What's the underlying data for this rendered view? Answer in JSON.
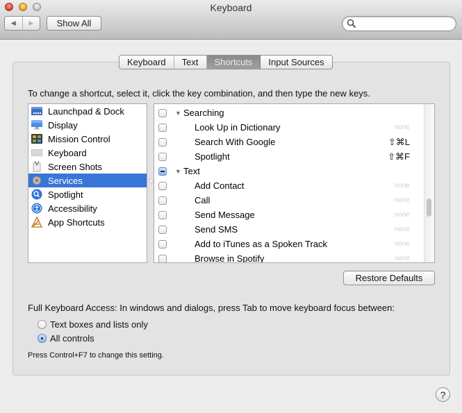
{
  "window": {
    "title": "Keyboard",
    "controls": [
      "close",
      "minimize",
      "zoom"
    ]
  },
  "toolbar": {
    "back_icon": "back-arrow-icon",
    "forward_icon": "forward-arrow-icon",
    "show_all_label": "Show All",
    "search": {
      "value": "",
      "placeholder": "",
      "icon": "magnifier-icon"
    }
  },
  "tabs": [
    {
      "label": "Keyboard",
      "active": false
    },
    {
      "label": "Text",
      "active": false
    },
    {
      "label": "Shortcuts",
      "active": true
    },
    {
      "label": "Input Sources",
      "active": false
    }
  ],
  "instruction": "To change a shortcut, select it, click the key combination, and then type the new keys.",
  "categories": [
    {
      "label": "Launchpad & Dock",
      "icon": "launchpad-dock-icon",
      "selected": false
    },
    {
      "label": "Display",
      "icon": "display-icon",
      "selected": false
    },
    {
      "label": "Mission Control",
      "icon": "mission-control-icon",
      "selected": false
    },
    {
      "label": "Keyboard",
      "icon": "keyboard-icon",
      "selected": false
    },
    {
      "label": "Screen Shots",
      "icon": "screen-shots-icon",
      "selected": false
    },
    {
      "label": "Services",
      "icon": "services-gear-icon",
      "selected": true
    },
    {
      "label": "Spotlight",
      "icon": "spotlight-icon",
      "selected": false
    },
    {
      "label": "Accessibility",
      "icon": "accessibility-icon",
      "selected": false
    },
    {
      "label": "App Shortcuts",
      "icon": "app-shortcuts-icon",
      "selected": false
    }
  ],
  "shortcuts": [
    {
      "type": "group",
      "label": "Searching",
      "checkbox": "unchecked",
      "expanded": true,
      "key": ""
    },
    {
      "type": "item",
      "label": "Look Up in Dictionary",
      "checkbox": "unchecked",
      "key": "none"
    },
    {
      "type": "item",
      "label": "Search With Google",
      "checkbox": "unchecked",
      "key": "⇧⌘L"
    },
    {
      "type": "item",
      "label": "Spotlight",
      "checkbox": "unchecked",
      "key": "⇧⌘F"
    },
    {
      "type": "group",
      "label": "Text",
      "checkbox": "mixed",
      "expanded": true,
      "key": ""
    },
    {
      "type": "item",
      "label": "Add Contact",
      "checkbox": "unchecked",
      "key": "none"
    },
    {
      "type": "item",
      "label": "Call",
      "checkbox": "unchecked",
      "key": "none"
    },
    {
      "type": "item",
      "label": "Send Message",
      "checkbox": "unchecked",
      "key": "none"
    },
    {
      "type": "item",
      "label": "Send SMS",
      "checkbox": "unchecked",
      "key": "none"
    },
    {
      "type": "item",
      "label": "Add to iTunes as a Spoken Track",
      "checkbox": "unchecked",
      "key": "none"
    },
    {
      "type": "item",
      "label": "Browse in Spotify",
      "checkbox": "unchecked",
      "key": "none"
    }
  ],
  "restore_defaults_label": "Restore Defaults",
  "full_keyboard_access": {
    "label": "Full Keyboard Access: In windows and dialogs, press Tab to move keyboard focus between:",
    "options": [
      {
        "label": "Text boxes and lists only",
        "selected": false
      },
      {
        "label": "All controls",
        "selected": true
      }
    ],
    "note": "Press Control+F7 to change this setting."
  },
  "help_label": "?",
  "colors": {
    "selection": "#3875d7",
    "active_tab": "#8f8f8f",
    "window_bg": "#ececec",
    "group_bg": "#e3e3e3"
  }
}
